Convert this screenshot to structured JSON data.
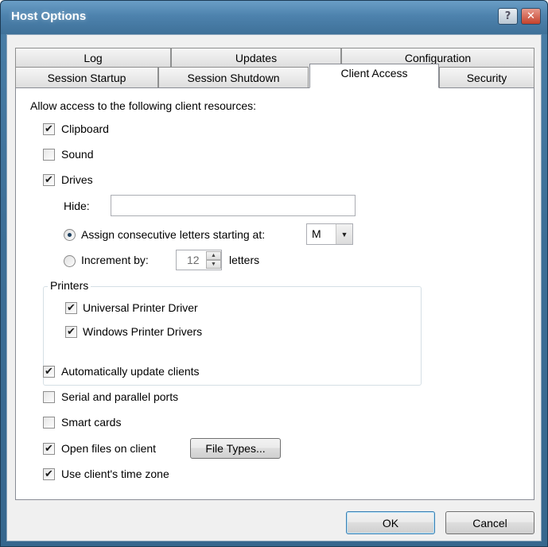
{
  "window": {
    "title": "Host Options"
  },
  "tabs": {
    "row1": [
      "Log",
      "Updates",
      "Configuration"
    ],
    "row2": [
      "Session Startup",
      "Session Shutdown",
      "Client Access",
      "Security"
    ],
    "active": "Client Access"
  },
  "panel": {
    "intro": "Allow access to the following client resources:",
    "clipboard": {
      "label": "Clipboard",
      "checked": true
    },
    "sound": {
      "label": "Sound",
      "checked": false
    },
    "drives": {
      "label": "Drives",
      "checked": true
    },
    "hide": {
      "label": "Hide:",
      "value": ""
    },
    "assign": {
      "label": "Assign consecutive letters starting at:",
      "selected": true,
      "letter": "M"
    },
    "increment": {
      "label": "Increment by:",
      "selected": false,
      "value": "12",
      "suffix": "letters"
    },
    "printers": {
      "title": "Printers",
      "universal": {
        "label": "Universal Printer Driver",
        "checked": true
      },
      "windows": {
        "label": "Windows Printer Drivers",
        "checked": true
      }
    },
    "auto_update": {
      "label": "Automatically update clients",
      "checked": true
    },
    "serial": {
      "label": "Serial and parallel ports",
      "checked": false
    },
    "smart": {
      "label": "Smart cards",
      "checked": false
    },
    "open_files": {
      "label": "Open files on client",
      "checked": true
    },
    "file_types_button": "File Types...",
    "time_zone": {
      "label": "Use client's time zone",
      "checked": true
    }
  },
  "buttons": {
    "ok": "OK",
    "cancel": "Cancel"
  },
  "colors": {
    "titlebar": "#4d82ad",
    "client_bg": "#f0f0f0",
    "panel_bg": "#ffffff"
  }
}
